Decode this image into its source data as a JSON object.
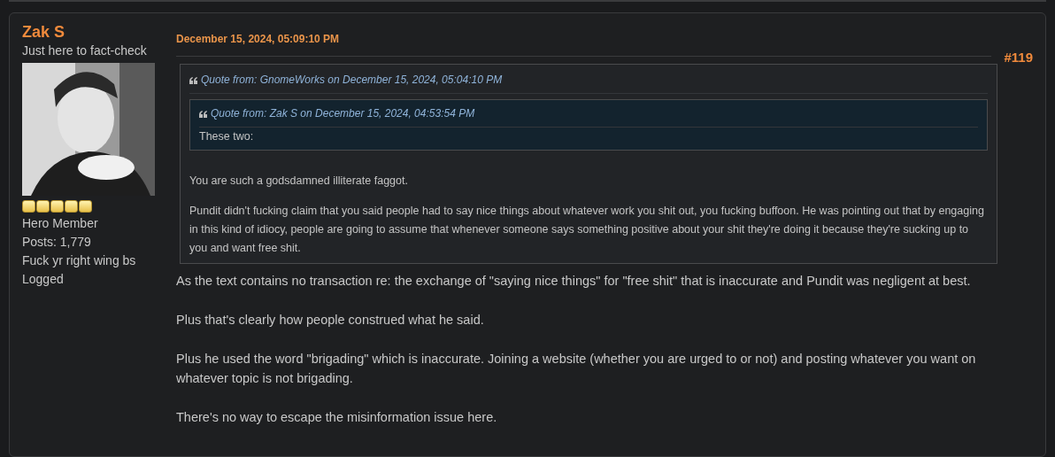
{
  "poster": {
    "name": "Zak S",
    "title": "Just here to fact-check",
    "stars": 5,
    "rank": "Hero Member",
    "posts": "Posts: 1,779",
    "signature": "Fuck yr right wing bs",
    "logged": "Logged"
  },
  "post": {
    "date": "December 15, 2024, 05:09:10 PM",
    "number": "#119",
    "quote": {
      "header": "Quote from: GnomeWorks on December 15, 2024, 05:04:10 PM",
      "nested": {
        "header": "Quote from: Zak S on December 15, 2024, 04:53:54 PM",
        "paragraphs": [
          "These two:"
        ]
      },
      "paragraphs": [
        "You are such a godsdamned illiterate faggot.",
        "Pundit didn't fucking claim that you said people had to say nice things about whatever work you shit out, you fucking buffoon. He was pointing out that by engaging in this kind of idiocy, people are going to assume that whenever someone says something positive about your shit they're doing it because they're sucking up to you and want free shit."
      ]
    },
    "paragraphs": [
      "As the text contains no transaction re: the exchange of \"saying nice things\" for \"free shit\" that is inaccurate and Pundit was negligent at best.",
      "Plus that's clearly how people construed what he said.",
      "Plus he used the word \"brigading\" which is inaccurate. Joining a website (whether you are urged to or not) and posting whatever you want on whatever topic is not brigading.",
      "There's no way to escape the misinformation issue here."
    ]
  }
}
